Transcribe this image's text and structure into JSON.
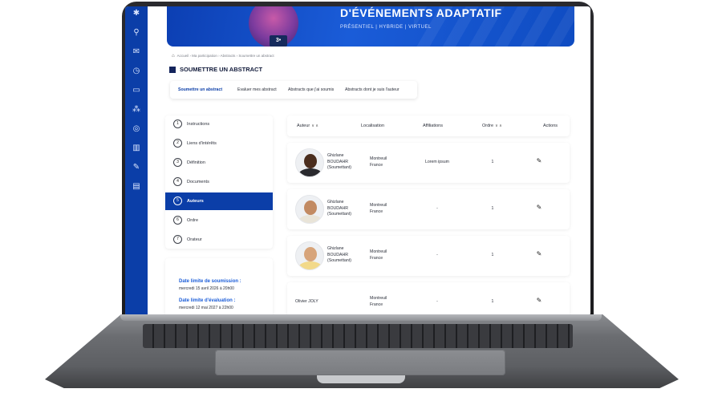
{
  "hero": {
    "title": "D'ÉVÉNEMENTS ADAPTATIF",
    "subtitle": "PRÉSENTIEL | HYBRIDE | VIRTUEL",
    "device_label": "3•"
  },
  "sidebar": {
    "icons": [
      "logo-icon",
      "bag-icon",
      "mail-icon",
      "clock-icon",
      "book-icon",
      "network-icon",
      "globe-icon",
      "library-icon",
      "edit-icon",
      "form-icon"
    ]
  },
  "breadcrumb": "Accueil › Ma participation › Abstracts › Soumettre un abstract",
  "page_title": "SOUMETTRE UN ABSTRACT",
  "tabs": [
    {
      "label": "Soumettre un abstract"
    },
    {
      "label": "Evaluer mes abstract"
    },
    {
      "label": "Abstracts que j'ai soumis"
    },
    {
      "label": "Abstracts dont je suis l'auteur"
    }
  ],
  "steps": [
    {
      "num": "1",
      "label": "Instructions"
    },
    {
      "num": "2",
      "label": "Liens d'intérêts"
    },
    {
      "num": "3",
      "label": "Définition"
    },
    {
      "num": "4",
      "label": "Documents"
    },
    {
      "num": "5",
      "label": "Auteurs"
    },
    {
      "num": "6",
      "label": "Ordre"
    },
    {
      "num": "7",
      "label": "Orateur"
    }
  ],
  "active_step": "Auteurs",
  "deadlines": {
    "submission_label": "Date limite de soumission :",
    "submission_value": "mercredi 15 avril 2026 à 20h00",
    "evaluation_label": "Date limite d'évaluation :",
    "evaluation_value": "mercredi 12 mai 2027 à 22h00"
  },
  "table": {
    "headers": {
      "author": "Auteur",
      "location": "Localisation",
      "affiliations": "Affiliations",
      "order": "Ordre",
      "actions": "Actions"
    },
    "rows": [
      {
        "name_line1": "Ghizlane",
        "name_line2": "BOUDAHR",
        "name_line3": "(Soumettant)",
        "city": "Montreuil",
        "country": "France",
        "affiliation": "Lorem ipsum",
        "order": "1"
      },
      {
        "name_line1": "Ghizlane",
        "name_line2": "BOUDAHR",
        "name_line3": "(Soumettant)",
        "city": "Montreuil",
        "country": "France",
        "affiliation": "-",
        "order": "1"
      },
      {
        "name_line1": "Ghizlane",
        "name_line2": "BOUDAHR",
        "name_line3": "(Soumettant)",
        "city": "Montreuil",
        "country": "France",
        "affiliation": "-",
        "order": "1"
      },
      {
        "name_line1": "Olivier JOLY",
        "city": "Montreuil",
        "country": "France",
        "affiliation": "-",
        "order": "1"
      }
    ]
  },
  "colors": {
    "primary": "#0b3ea8",
    "accent": "#1a5cd8",
    "title_dark": "#111a3a"
  }
}
